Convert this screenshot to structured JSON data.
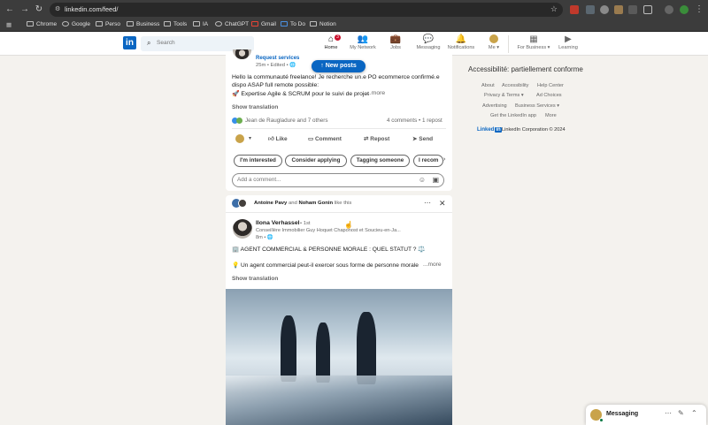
{
  "browser": {
    "url": "linkedin.com/feed/",
    "bookmarks": [
      "Chrome",
      "Google",
      "Perso",
      "Business",
      "Tools",
      "IA",
      "ChatGPT",
      "Gmail",
      "To Do",
      "Notion"
    ]
  },
  "header": {
    "search_placeholder": "Search",
    "nav": [
      {
        "label": "Home",
        "badge": "3"
      },
      {
        "label": "My Network"
      },
      {
        "label": "Jobs"
      },
      {
        "label": "Messaging"
      },
      {
        "label": "Notifications"
      },
      {
        "label": "Me ▾"
      },
      {
        "label": "For Business ▾"
      },
      {
        "label": "Learning"
      }
    ]
  },
  "feed": {
    "new_posts": "↑ New posts",
    "post1": {
      "author_sub": "Request services",
      "meta": "25m • Edited • 🌐",
      "line1": "Hello la communauté freelance! Je recherche un.e PO ecommerce confirmé.e",
      "line2": "dispo ASAP full remote possible:",
      "line3": "🚀 Expertise Agile & SCRUM pour le suivi de projet",
      "more": "...more",
      "show_translation": "Show translation",
      "reactions": "Jean de Raugladure and 7 others",
      "stats": "4 comments • 1 repost",
      "actions": [
        "Like",
        "Comment",
        "Repost",
        "Send"
      ],
      "pills": [
        "I'm interested",
        "Consider applying",
        "Tagging someone",
        "I recom"
      ],
      "comment_placeholder": "Add a comment..."
    },
    "post2": {
      "social_prefix": "Antoine Pavy",
      "social_and": "and",
      "social_name2": "Noham Gonin",
      "social_suffix": "like this",
      "author": "Ilona Verhassel",
      "degree": "• 1st",
      "headline": "Conseillère Immobilier Guy Hoquet Chaponost et Soucieu-en-Ja...",
      "meta": "8m • 🌐",
      "line1": "🏢 AGENT COMMERCIAL & PERSONNE MORALE : QUEL STATUT ? ⚖️",
      "line2": "💡 Un agent commercial peut-il exercer sous forme de personne morale",
      "more": "...more",
      "show_translation": "Show translation"
    }
  },
  "rail": {
    "title": "Accessibilité: partiellement conforme",
    "links": [
      "About",
      "Accessibility",
      "Help Center",
      "Privacy & Terms ▾",
      "Ad Choices",
      "Advertising",
      "Business Services ▾",
      "Get the LinkedIn app",
      "More"
    ],
    "copyright": "LinkedIn Corporation © 2024",
    "brand": "Linked"
  },
  "messaging": {
    "label": "Messaging"
  },
  "colors": {
    "brand": "#0a66c2",
    "accent_green": "#057642"
  }
}
